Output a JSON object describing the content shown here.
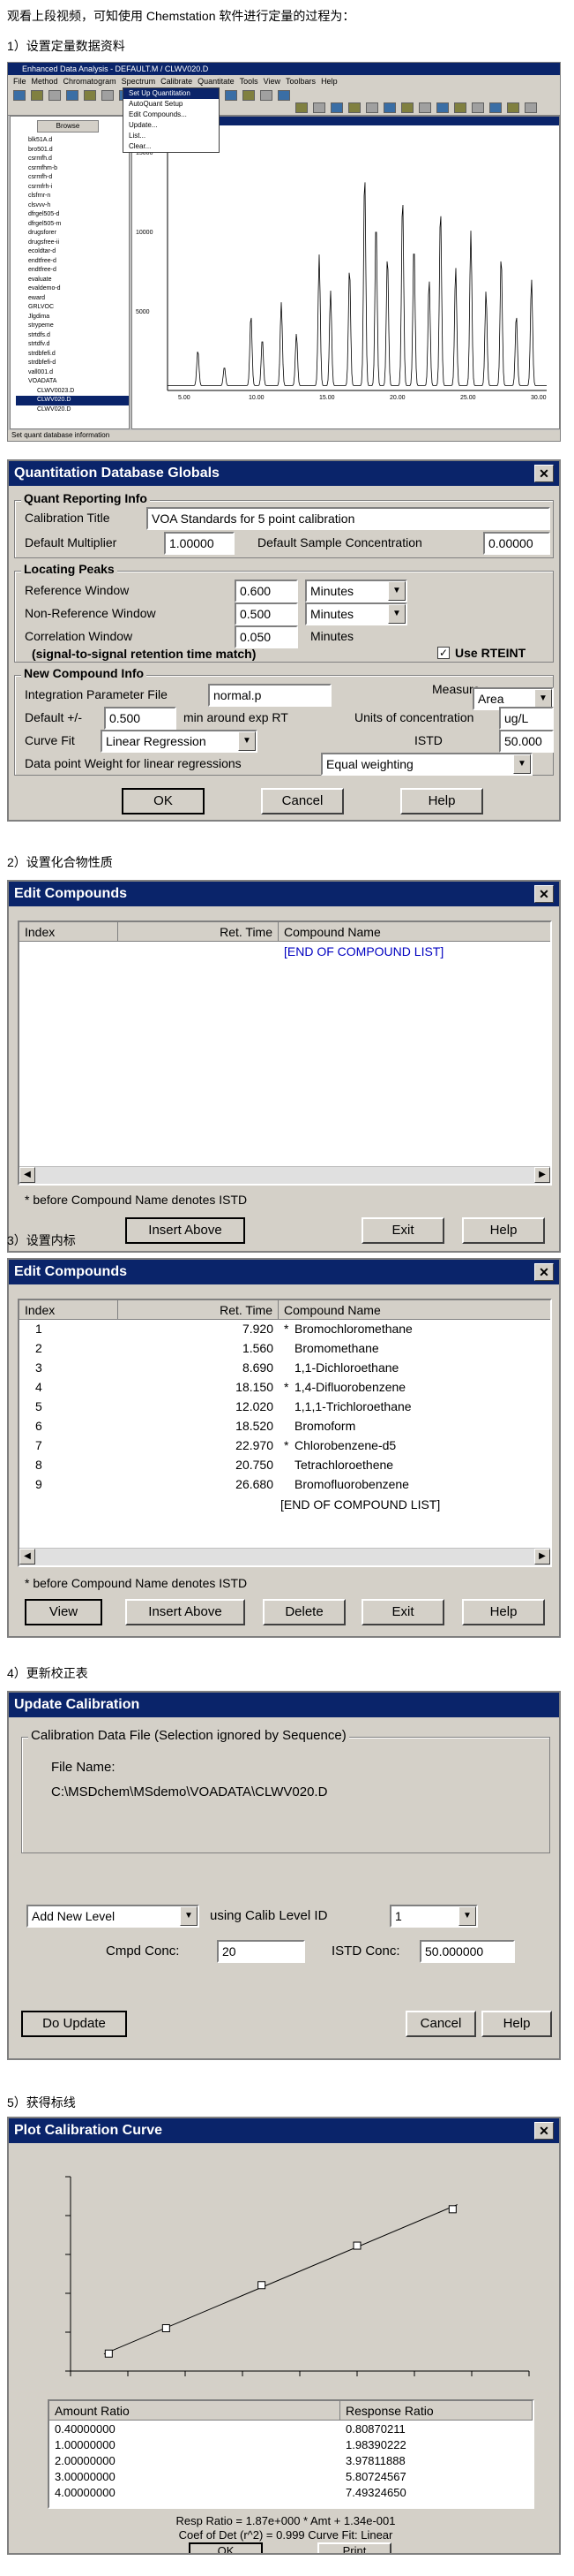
{
  "intro": "观看上段视频，可知使用 Chemstation 软件进行定量的过程为：",
  "steps": [
    "1）设置定量数据资料",
    "2）设置化合物性质",
    "3）设置内标",
    "4）更新校正表",
    "5）获得标线"
  ],
  "colors": {
    "title_bar": "#0a246a",
    "dialog_bg": "#d4d0c8",
    "list_blue": "#0000c0"
  },
  "ws": {
    "title": "Enhanced Data Analysis - DEFAULT.M / CLWV020.D",
    "menus": [
      "File",
      "Method",
      "Chromatogram",
      "Spectrum",
      "Calibrate",
      "Quantitate",
      "Tools",
      "View",
      "Toolbars",
      "Help"
    ],
    "dropdown": [
      "Set Up Quantitation",
      "AutoQuant Setup",
      "Edit Compounds...",
      "Update...",
      "List...",
      "Clear..."
    ],
    "status": "Set quant database information",
    "files": [
      "blk51A.d",
      "bro501.d",
      "csrmfh.d",
      "csrmfhm-b",
      "csrmfh-d",
      "csrmfrh-i",
      "clsfrnr-n",
      "clsvvv-h",
      "dfrgel505-d",
      "dfrgel505-m",
      "drugsforer",
      "drugsfree-ii",
      "ecoldtar-d",
      "endtfree-d",
      "endtfree-d",
      "evaluate",
      "evaldemo-d",
      "eward",
      "GRLVOC",
      "Jlgdima",
      "strypeme",
      "strtdfs.d",
      "strtdfv.d",
      "strdbfefi.d",
      "strdbfefi-d",
      "vall001.d",
      "VOADATA",
      "CLWV0023.D",
      "CLWV020.D",
      "CLWV020.D"
    ],
    "xticks": [
      "5.00",
      "10.00",
      "15.00",
      "20.00",
      "25.00",
      "30.00"
    ],
    "yticks": [
      "15000",
      "10000",
      "5000"
    ]
  },
  "qdg": {
    "title": "Quantitation Database Globals",
    "reporting_info": "Quant Reporting Info",
    "calibration_title_label": "Calibration Title",
    "calibration_title_value": "VOA  Standards for 5 point calibration",
    "default_multiplier_label": "Default Multiplier",
    "default_multiplier_value": "1.00000",
    "default_sample_conc_label": "Default Sample Concentration",
    "default_sample_conc_value": "0.00000",
    "locating_peaks": "Locating Peaks",
    "ref_window_label": "Reference Window",
    "ref_window_value": "0.600",
    "ref_window_unit": "Minutes",
    "nonref_window_label": "Non-Reference Window",
    "nonref_window_value": "0.500",
    "nonref_window_unit": "Minutes",
    "corr_window_label": "Correlation Window",
    "corr_window_value": "0.050",
    "corr_window_unit": "Minutes",
    "signal_note": "(signal-to-signal retention time match)",
    "use_rteint": "Use RTEINT",
    "new_compound_info": "New Compound Info",
    "integration_file_label": "Integration Parameter File",
    "integration_file_value": "normal.p",
    "measure_label": "Measure",
    "measure_value": "Area",
    "default_pm_label": "Default +/-",
    "default_pm_value": "0.500",
    "min_around": "min around exp RT",
    "units_label": "Units of concentration",
    "units_value": "ug/L",
    "curve_fit_label": "Curve Fit",
    "curve_fit_value": "Linear Regression",
    "istd_label": "ISTD",
    "istd_value": "50.000",
    "weight_label": "Data point Weight for linear regressions",
    "weight_value": "Equal weighting",
    "ok": "OK",
    "cancel": "Cancel",
    "help": "Help"
  },
  "ec1": {
    "title": "Edit Compounds",
    "headers": [
      "Index",
      "Ret. Time",
      "Compound Name"
    ],
    "end_label": "[END OF COMPOUND LIST]",
    "note": "* before Compound Name denotes ISTD",
    "insert_above": "Insert Above",
    "exit": "Exit",
    "help": "Help"
  },
  "ec2": {
    "title": "Edit Compounds",
    "headers": [
      "Index",
      "Ret. Time",
      "Compound Name"
    ],
    "rows": [
      {
        "index": "1",
        "rt": "7.920",
        "star": "*",
        "name": "Bromochloromethane"
      },
      {
        "index": "2",
        "rt": "1.560",
        "star": "",
        "name": "Bromomethane"
      },
      {
        "index": "3",
        "rt": "8.690",
        "star": "",
        "name": "1,1-Dichloroethane"
      },
      {
        "index": "4",
        "rt": "18.150",
        "star": "*",
        "name": "1,4-Difluorobenzene"
      },
      {
        "index": "5",
        "rt": "12.020",
        "star": "",
        "name": "1,1,1-Trichloroethane"
      },
      {
        "index": "6",
        "rt": "18.520",
        "star": "",
        "name": "Bromoform"
      },
      {
        "index": "7",
        "rt": "22.970",
        "star": "*",
        "name": "Chlorobenzene-d5"
      },
      {
        "index": "8",
        "rt": "20.750",
        "star": "",
        "name": "Tetrachloroethene"
      },
      {
        "index": "9",
        "rt": "26.680",
        "star": "",
        "name": "Bromofluorobenzene"
      }
    ],
    "end_label": "[END OF COMPOUND LIST]",
    "note": "* before Compound Name denotes ISTD",
    "view": "View",
    "insert_above": "Insert Above",
    "delete": "Delete",
    "exit": "Exit",
    "help": "Help"
  },
  "uc": {
    "title": "Update Calibration",
    "group": "Calibration Data File (Selection ignored by Sequence)",
    "file_name_label": "File Name:",
    "file_path": "C:\\MSDchem\\MSdemo\\VOADATA\\CLWV020.D",
    "action": "Add New Level",
    "using_label": "using Calib Level ID",
    "level_id": "1",
    "cmpd_label": "Cmpd Conc:",
    "cmpd_value": "20",
    "istd_label": "ISTD Conc:",
    "istd_value": "50.000000",
    "do_update": "Do Update",
    "cancel": "Cancel",
    "help": "Help"
  },
  "pc": {
    "title": "Plot Calibration Curve",
    "col_amount": "Amount Ratio",
    "col_response": "Response Ratio",
    "rows": [
      {
        "amount": "0.40000000",
        "response": "0.80870211"
      },
      {
        "amount": "1.00000000",
        "response": "1.98390222"
      },
      {
        "amount": "2.00000000",
        "response": "3.97811888"
      },
      {
        "amount": "3.00000000",
        "response": "5.80724567"
      },
      {
        "amount": "4.00000000",
        "response": "7.49324650"
      }
    ],
    "resp_eq": "Resp Ratio = 1.87e+000 * Amt + 1.34e-001",
    "coef": "Coef of Det (r^2) = 0.999   Curve Fit: Linear",
    "ok": "OK",
    "print": "Print"
  },
  "chart_data": {
    "type": "scatter",
    "x": [
      0.4,
      1.0,
      2.0,
      3.0,
      4.0
    ],
    "y": [
      0.80870211,
      1.98390222,
      3.97811888,
      5.80724567,
      7.4932465
    ],
    "fit": {
      "slope": 1.87,
      "intercept": 0.134
    },
    "xlim": [
      0,
      4.8
    ],
    "ylim": [
      0,
      9
    ],
    "grid": false
  }
}
